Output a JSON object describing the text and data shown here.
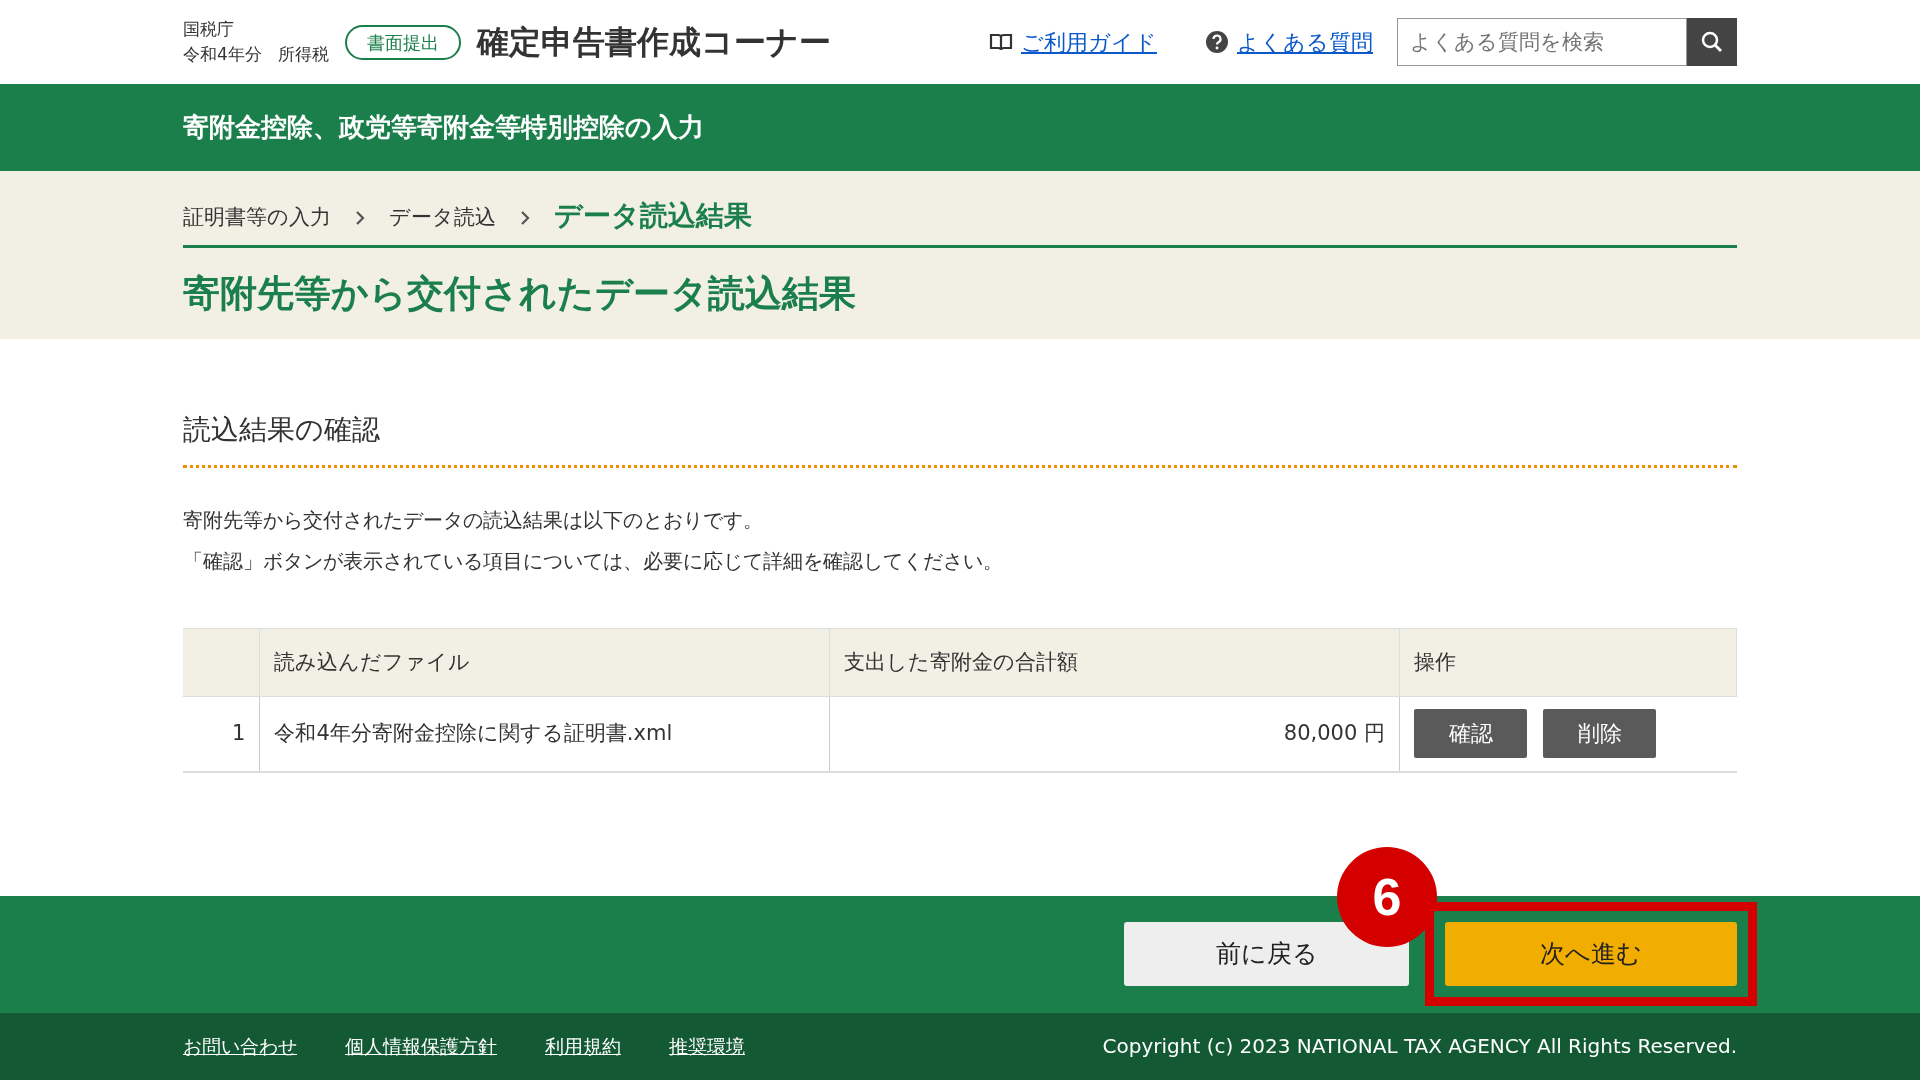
{
  "header": {
    "agency": "国税庁",
    "year_tax": [
      "令和4年分",
      "所得税"
    ],
    "mode_badge": "書面提出",
    "site_title": "確定申告書作成コーナー",
    "links": [
      {
        "kind": "guide",
        "label": "ご利用ガイド"
      },
      {
        "kind": "faq",
        "label": "よくある質問"
      }
    ],
    "search": {
      "placeholder": "よくある質問を検索"
    }
  },
  "page_band": {
    "title": "寄附金控除、政党等寄附金等特別控除の入力"
  },
  "breadcrumb": [
    {
      "label": "証明書等の入力",
      "selected": false
    },
    {
      "label": "データ読込",
      "selected": false
    },
    {
      "label": "データ読込結果",
      "selected": true
    }
  ],
  "page_title": "寄附先等から交付されたデータ読込結果",
  "section": {
    "heading": "読込結果の確認",
    "paragraphs": [
      "寄附先等から交付されたデータの読込結果は以下のとおりです。",
      "「確認」ボタンが表示されている項目については、必要に応じて詳細を確認してください。"
    ]
  },
  "table": {
    "columns": [
      "",
      "読み込んだファイル",
      "支出した寄附金の合計額",
      "操作"
    ],
    "rows": [
      {
        "number": "1",
        "file": "令和4年分寄附金控除に関する証明書.xml",
        "amount": "80,000 円",
        "actions": [
          "確認",
          "削除"
        ]
      }
    ]
  },
  "actions": {
    "back": "前に戻る",
    "next": "次へ進む"
  },
  "annotation": {
    "step": "6"
  },
  "footer": {
    "links": [
      "お問い合わせ",
      "個人情報保護方針",
      "利用規約",
      "推奨環境"
    ],
    "copyright": "Copyright (c) 2023 NATIONAL TAX AGENCY All Rights Reserved."
  }
}
